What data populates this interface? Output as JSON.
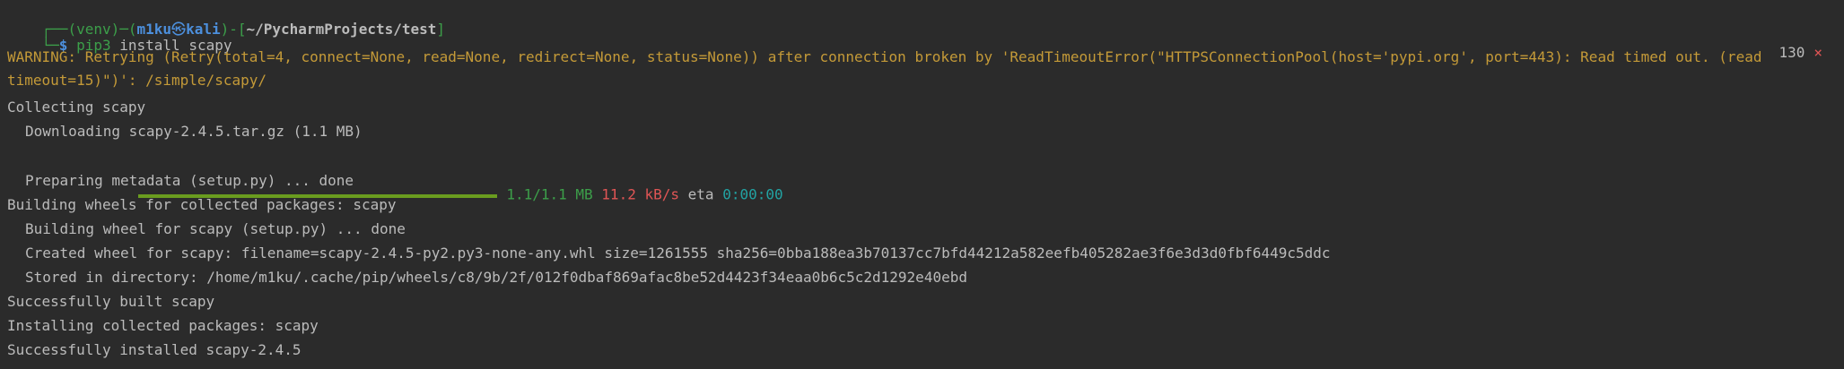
{
  "prompt": {
    "frame_top": "┌──",
    "venv": "(venv)",
    "dash": "─",
    "user_open": "(",
    "user": "m1ku",
    "at_symbol": "㉿",
    "host": "kali",
    "user_close": ")",
    "path_open": "-[",
    "path": "~/PycharmProjects/test",
    "path_close": "]",
    "frame_bottom": "└─",
    "symbol": "$",
    "command": "pip3",
    "args": "install scapy",
    "exit_code": "130",
    "exit_mark": "×"
  },
  "output": {
    "warning_1": "WARNING: Retrying (Retry(total=4, connect=None, read=None, redirect=None, status=None)) after connection broken by 'ReadTimeoutError(\"HTTPSConnectionPool(host='pypi.org', port=443): Read timed out. (read",
    "warning_2": "timeout=15)\")': /simple/scapy/",
    "collecting": "Collecting scapy",
    "downloading": "Downloading scapy-2.4.5.tar.gz (1.1 MB)",
    "progress": {
      "fraction": 1.0,
      "size": "1.1/1.1 MB",
      "speed": "11.2 kB/s",
      "eta_label": "eta",
      "eta": "0:00:00"
    },
    "preparing": "Preparing metadata (setup.py) ... done",
    "building_wheels": "Building wheels for collected packages: scapy",
    "building_wheel": "Building wheel for scapy (setup.py) ... done",
    "created_wheel": "Created wheel for scapy: filename=scapy-2.4.5-py2.py3-none-any.whl size=1261555 sha256=0bba188ea3b70137cc7bfd44212a582eefb405282ae3f6e3d3d0fbf6449c5ddc",
    "stored": "Stored in directory: /home/m1ku/.cache/pip/wheels/c8/9b/2f/012f0dbaf869afac8be52d4423f34eaa0b6c5c2d1292e40ebd",
    "success_built": "Successfully built scapy",
    "installing": "Installing collected packages: scapy",
    "success_installed": "Successfully installed scapy-2.4.5"
  },
  "colors": {
    "background": "#2b2b2b",
    "text": "#bbbbbb",
    "prompt_green": "#3c9f4a",
    "prompt_blue": "#4c8fdc",
    "warning": "#c49a38",
    "progress_bar": "#6a9c1f",
    "speed_red": "#e05555",
    "eta_cyan": "#22a3a3"
  }
}
